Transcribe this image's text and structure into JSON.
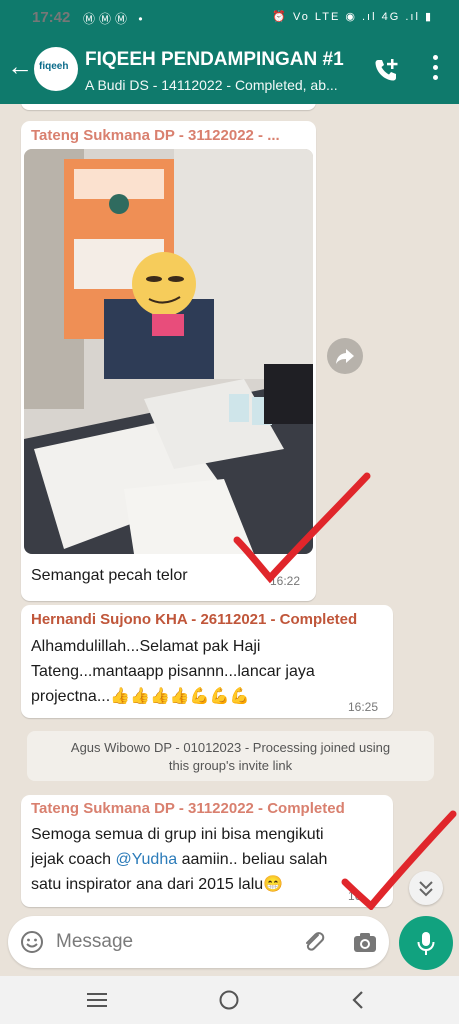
{
  "status_bar": {
    "time": "17:42",
    "notification_icons": "ⓂⓂⓂ •",
    "right_icons": "⏰ Vo LTE ◉ .ıl 4G .ıl ▮"
  },
  "header": {
    "group_initials": "fiqeeh",
    "title": "FIQEEH PENDAMPINGAN #1",
    "subtitle": "A Budi DS - 14112022 - Completed, ab..."
  },
  "messages": [
    {
      "sender": "Tateng Sukmana DP - 31122022 - ...",
      "caption": "Semangat pecah telor",
      "time": "16:22"
    },
    {
      "sender": "Hernandi Sujono KHA - 26112021 - Completed",
      "text_line1": "Alhamdulillah...Selamat pak Haji",
      "text_line2": "Tateng...mantaapp pisannn...lancar jaya",
      "text_line3": "projectna...👍👍👍👍💪💪💪",
      "time": "16:25"
    },
    {
      "system_line1": "Agus Wibowo DP - 01012023 - Processing joined using",
      "system_line2": "this group's invite link"
    },
    {
      "sender": "Tateng Sukmana DP - 31122022 - Completed",
      "text_line1": "Semoga semua di grup ini bisa mengikuti",
      "text_pre_mention": "jejak coach ",
      "mention": "@Yudha",
      "text_post_mention": " aamiin.. beliau salah",
      "text_line3": "satu inspirator ana dari 2015 lalu😁",
      "time": "16"
    }
  ],
  "compose": {
    "placeholder": "Message"
  },
  "colors": {
    "header": "#0f7a6c",
    "sender1": "#d9806f",
    "sender2": "#c0563a",
    "mention": "#2b7bb9",
    "mic": "#11a27f",
    "check": "#e0262b"
  }
}
